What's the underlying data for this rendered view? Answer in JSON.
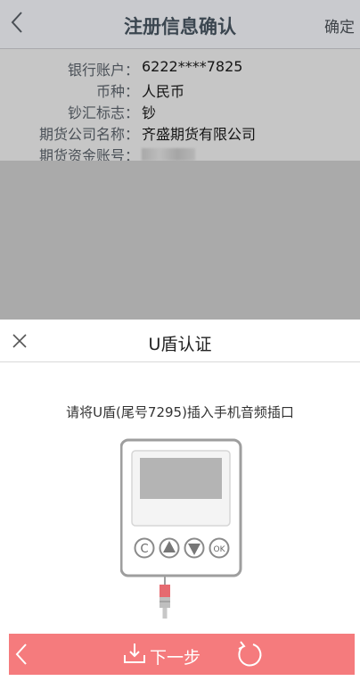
{
  "header": {
    "title": "注册信息确认",
    "confirm_label": "确定",
    "back_icon": "chevron-left-icon"
  },
  "info": {
    "rows": [
      {
        "label": "银行账户：",
        "value": "6222****7825"
      },
      {
        "label": "币种：",
        "value": "人民币"
      },
      {
        "label": "钞汇标志：",
        "value": "钞"
      },
      {
        "label": "期货公司名称：",
        "value": "齐盛期货有限公司"
      },
      {
        "label": "期货资金账号：",
        "value": ""
      }
    ]
  },
  "sheet": {
    "title": "U盾认证",
    "close_icon": "close-icon",
    "instruction": "请将U盾(尾号7295)插入手机音频插口",
    "device_icon": "usb-key-device-icon"
  },
  "action_bar": {
    "next_label": "下一步",
    "prev_icon": "chevron-left-icon",
    "download_icon": "download-icon",
    "refresh_icon": "refresh-icon"
  },
  "colors": {
    "header_bg": "#c9cace",
    "overlay_bg": "#aaaaaa",
    "accent": "#f57b7d",
    "title_text": "#3b4650"
  }
}
